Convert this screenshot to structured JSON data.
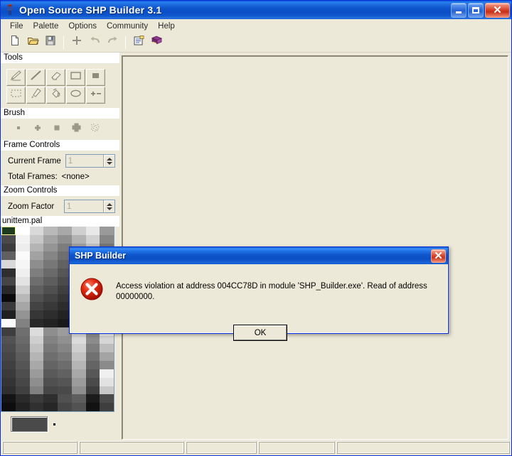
{
  "window": {
    "title": "Open Source SHP Builder 3.1",
    "app_icon": "figure-icon",
    "buttons": {
      "minimize": "minimize-button",
      "maximize": "maximize-button",
      "close": "close-button"
    },
    "accent_color": "#0831d9",
    "face_color": "#ece9d8"
  },
  "menubar": {
    "items": [
      {
        "label": "File"
      },
      {
        "label": "Palette"
      },
      {
        "label": "Options"
      },
      {
        "label": "Community"
      },
      {
        "label": "Help"
      }
    ]
  },
  "toolbar": {
    "buttons": [
      {
        "name": "new-file-icon",
        "tip": "New"
      },
      {
        "name": "open-file-icon",
        "tip": "Open"
      },
      {
        "name": "save-file-icon",
        "tip": "Save"
      },
      {
        "name": "add-frame-icon",
        "tip": "Add"
      },
      {
        "name": "undo-icon",
        "tip": "Undo"
      },
      {
        "name": "redo-icon",
        "tip": "Redo"
      },
      {
        "name": "properties-icon",
        "tip": "Properties"
      },
      {
        "name": "book-icon",
        "tip": "Manual"
      }
    ]
  },
  "sidebar": {
    "tools_header": "Tools",
    "tools": [
      {
        "name": "pencil-tool-icon"
      },
      {
        "name": "line-tool-icon"
      },
      {
        "name": "eraser-tool-icon"
      },
      {
        "name": "rectangle-tool-icon"
      },
      {
        "name": "filled-rectangle-tool-icon"
      },
      {
        "name": "select-tool-icon"
      },
      {
        "name": "eyedropper-tool-icon"
      },
      {
        "name": "fill-tool-icon"
      },
      {
        "name": "ellipse-tool-icon"
      },
      {
        "name": "plus-minus-tool-icon"
      }
    ],
    "brush_header": "Brush",
    "brushes": [
      {
        "name": "brush-dot-small-icon"
      },
      {
        "name": "brush-cross-small-icon"
      },
      {
        "name": "brush-square-icon"
      },
      {
        "name": "brush-cross-large-icon"
      },
      {
        "name": "brush-spray-icon"
      }
    ],
    "frame_header": "Frame Controls",
    "current_frame_label": "Current Frame",
    "current_frame_value": "1",
    "total_frames_label": "Total Frames:",
    "total_frames_value": "<none>",
    "zoom_header": "Zoom Controls",
    "zoom_factor_label": "Zoom Factor",
    "zoom_factor_value": "1"
  },
  "palette": {
    "filename": "unittem.pal",
    "selected_index": 0,
    "current_color": "#4a4a4a",
    "columns": 8,
    "swatches": [
      "#1f3b1f",
      "#ffffff",
      "#d9d9d9",
      "#b9b9b9",
      "#a8a8a8",
      "#cfcfcf",
      "#e8e8e8",
      "#9a9a9a",
      "#4a4a4a",
      "#f2f2f2",
      "#c7c7c7",
      "#a3a3a3",
      "#8f8f8f",
      "#b2b2b2",
      "#d2d2d2",
      "#868686",
      "#3c3c3c",
      "#ededed",
      "#b4b4b4",
      "#959595",
      "#7d7d7d",
      "#9e9e9e",
      "#c0c0c0",
      "#767676",
      "#606060",
      "#fafafa",
      "#a2a2a2",
      "#858585",
      "#6f6f6f",
      "#8c8c8c",
      "#adadad",
      "#6a6a6a",
      "#d8d8d8",
      "#f6f6f6",
      "#8e8e8e",
      "#777777",
      "#626262",
      "#7b7b7b",
      "#9a9a9a",
      "#5e5e5e",
      "#2e2e2e",
      "#efefef",
      "#7e7e7e",
      "#6a6a6a",
      "#565656",
      "#6c6c6c",
      "#8a8a8a",
      "#525252",
      "#454545",
      "#e3e3e3",
      "#6e6e6e",
      "#5d5d5d",
      "#4b4b4b",
      "#5e5e5e",
      "#797979",
      "#484848",
      "#282828",
      "#cdcdcd",
      "#5f5f5f",
      "#505050",
      "#404040",
      "#515151",
      "#696969",
      "#3e3e3e",
      "#0a0a0a",
      "#b8b8b8",
      "#515151",
      "#434343",
      "#363636",
      "#454545",
      "#5a5a5a",
      "#343434",
      "#3a3a3a",
      "#a6a6a6",
      "#434343",
      "#383838",
      "#2c2c2c",
      "#3a3a3a",
      "#4c4c4c",
      "#2b2b2b",
      "#202020",
      "#949494",
      "#363636",
      "#2d2d2d",
      "#232323",
      "#303030",
      "#3e3e3e",
      "#222222",
      "#fdfdfd",
      "#828282",
      "#292929",
      "#222222",
      "#1a1a1a",
      "#262626",
      "#313131",
      "#fefefe",
      "#3e3e3e",
      "#6f6f6f",
      "#dcdcdc",
      "#8e8e8e",
      "#9c9c9c",
      "#eaeaea",
      "#9a9a9a",
      "#ffffff",
      "#525252",
      "#6a6a6a",
      "#cfcfcf",
      "#828282",
      "#909090",
      "#dcdcdc",
      "#8c8c8c",
      "#d6d6d6",
      "#4c4c4c",
      "#636363",
      "#c2c2c2",
      "#787878",
      "#858585",
      "#cfcfcf",
      "#7e7e7e",
      "#bdbdbd",
      "#464646",
      "#5c5c5c",
      "#b5b5b5",
      "#6e6e6e",
      "#797979",
      "#c2c2c2",
      "#717171",
      "#a4a4a4",
      "#404040",
      "#555555",
      "#a8a8a8",
      "#646464",
      "#6d6d6d",
      "#b5b5b5",
      "#646464",
      "#8b8b8b",
      "#3a3a3a",
      "#4e4e4e",
      "#9b9b9b",
      "#5a5a5a",
      "#616161",
      "#a8a8a8",
      "#575757",
      "#f0f0f0",
      "#343434",
      "#474747",
      "#8e8e8e",
      "#505050",
      "#555555",
      "#9b9b9b",
      "#4a4a4a",
      "#e2e2e2",
      "#2e2e2e",
      "#404040",
      "#818181",
      "#464646",
      "#494949",
      "#8e8e8e",
      "#3d3d3d",
      "#c8c8c8",
      "#141414",
      "#2a2a2a",
      "#3a3a3a",
      "#2e2e2e",
      "#505050",
      "#5e5e5e",
      "#1b1b1b",
      "#4a4a4a",
      "#0d0d0d",
      "#222222",
      "#303030",
      "#262626",
      "#464646",
      "#525252",
      "#121212",
      "#3e3e3e"
    ]
  },
  "dialog": {
    "title": "SHP Builder",
    "icon": "error-icon",
    "message": "Access violation at address 004CC78D in module 'SHP_Builder.exe'. Read of address 00000000.",
    "ok_label": "OK",
    "close_button": "dialog-close-button"
  },
  "statusbar": {
    "panels": [
      "",
      "",
      "",
      "",
      ""
    ]
  }
}
